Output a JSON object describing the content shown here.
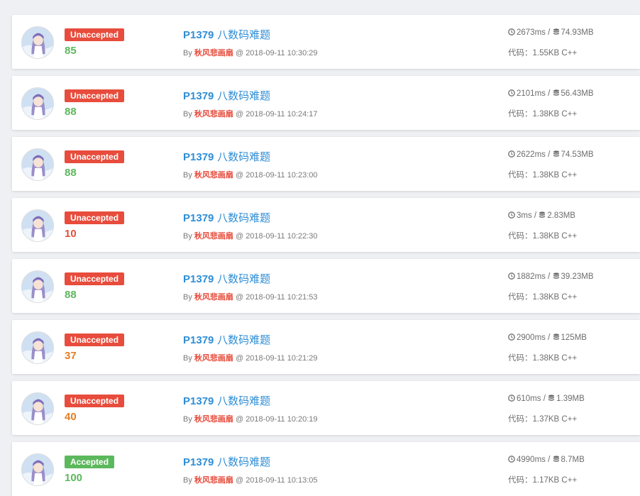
{
  "colors": {
    "unaccepted": "#e74c3c",
    "accepted": "#5cb85c",
    "score_green": "#5cb85c",
    "score_red": "#e74c3c",
    "score_orange": "#e67e22",
    "link": "#2f8ed6",
    "user": "#e74c3c"
  },
  "labels": {
    "by": "By ",
    "at": " @ ",
    "code_prefix": "代码：",
    "sep": " / "
  },
  "icons": {
    "time": "clock-icon",
    "memory": "database-icon",
    "avatar": "user-avatar"
  },
  "records": [
    {
      "status": "Unaccepted",
      "score": "85",
      "score_color": "green",
      "problem_id": "P1379",
      "problem_name": "八数码难题",
      "user": "秋风悲画扇",
      "time": "2018-09-11 10:30:29",
      "runtime": "2673ms",
      "memory": "74.93MB",
      "code": "1.55KB C++"
    },
    {
      "status": "Unaccepted",
      "score": "88",
      "score_color": "green",
      "problem_id": "P1379",
      "problem_name": "八数码难题",
      "user": "秋风悲画扇",
      "time": "2018-09-11 10:24:17",
      "runtime": "2101ms",
      "memory": "56.43MB",
      "code": "1.38KB C++"
    },
    {
      "status": "Unaccepted",
      "score": "88",
      "score_color": "green",
      "problem_id": "P1379",
      "problem_name": "八数码难题",
      "user": "秋风悲画扇",
      "time": "2018-09-11 10:23:00",
      "runtime": "2622ms",
      "memory": "74.53MB",
      "code": "1.38KB C++"
    },
    {
      "status": "Unaccepted",
      "score": "10",
      "score_color": "red",
      "problem_id": "P1379",
      "problem_name": "八数码难题",
      "user": "秋风悲画扇",
      "time": "2018-09-11 10:22:30",
      "runtime": "3ms",
      "memory": "2.83MB",
      "code": "1.38KB C++"
    },
    {
      "status": "Unaccepted",
      "score": "88",
      "score_color": "green",
      "problem_id": "P1379",
      "problem_name": "八数码难题",
      "user": "秋风悲画扇",
      "time": "2018-09-11 10:21:53",
      "runtime": "1882ms",
      "memory": "39.23MB",
      "code": "1.38KB C++"
    },
    {
      "status": "Unaccepted",
      "score": "37",
      "score_color": "orange",
      "problem_id": "P1379",
      "problem_name": "八数码难题",
      "user": "秋风悲画扇",
      "time": "2018-09-11 10:21:29",
      "runtime": "2900ms",
      "memory": "125MB",
      "code": "1.38KB C++"
    },
    {
      "status": "Unaccepted",
      "score": "40",
      "score_color": "orange",
      "problem_id": "P1379",
      "problem_name": "八数码难题",
      "user": "秋风悲画扇",
      "time": "2018-09-11 10:20:19",
      "runtime": "610ms",
      "memory": "1.39MB",
      "code": "1.37KB C++"
    },
    {
      "status": "Accepted",
      "score": "100",
      "score_color": "green",
      "problem_id": "P1379",
      "problem_name": "八数码难题",
      "user": "秋风悲画扇",
      "time": "2018-09-11 10:13:05",
      "runtime": "4990ms",
      "memory": "8.7MB",
      "code": "1.17KB C++"
    }
  ]
}
